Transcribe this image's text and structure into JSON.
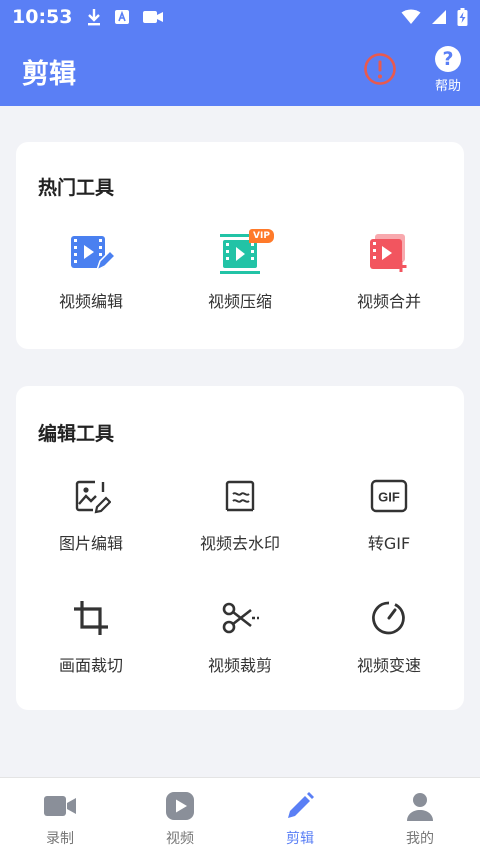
{
  "status_bar": {
    "time": "10:53"
  },
  "header": {
    "title": "剪辑",
    "help_label": "帮助"
  },
  "hot_tools": {
    "title": "热门工具",
    "items": [
      {
        "label": "视频编辑",
        "icon": "video-edit-icon"
      },
      {
        "label": "视频压缩",
        "icon": "video-compress-icon",
        "badge": "VIP"
      },
      {
        "label": "视频合并",
        "icon": "video-merge-icon"
      }
    ]
  },
  "edit_tools": {
    "title": "编辑工具",
    "items": [
      {
        "label": "图片编辑",
        "icon": "image-edit-icon"
      },
      {
        "label": "视频去水印",
        "icon": "remove-watermark-icon"
      },
      {
        "label": "转GIF",
        "icon": "gif-icon",
        "icon_text": "GIF"
      },
      {
        "label": "画面裁切",
        "icon": "crop-icon"
      },
      {
        "label": "视频裁剪",
        "icon": "scissors-icon"
      },
      {
        "label": "视频变速",
        "icon": "speed-icon"
      }
    ]
  },
  "tab_bar": {
    "items": [
      {
        "label": "录制",
        "icon": "camera-icon"
      },
      {
        "label": "视频",
        "icon": "play-icon"
      },
      {
        "label": "剪辑",
        "icon": "pencil-icon",
        "active": true
      },
      {
        "label": "我的",
        "icon": "user-icon"
      }
    ]
  },
  "colors": {
    "primary": "#5a7ff5",
    "blue_icon": "#4a80f0",
    "teal_icon": "#22c3a6",
    "red_icon": "#f2555f",
    "vip_badge": "#ff7a2a",
    "alert": "#e85a4f",
    "tab_inactive": "#8a8f99"
  }
}
